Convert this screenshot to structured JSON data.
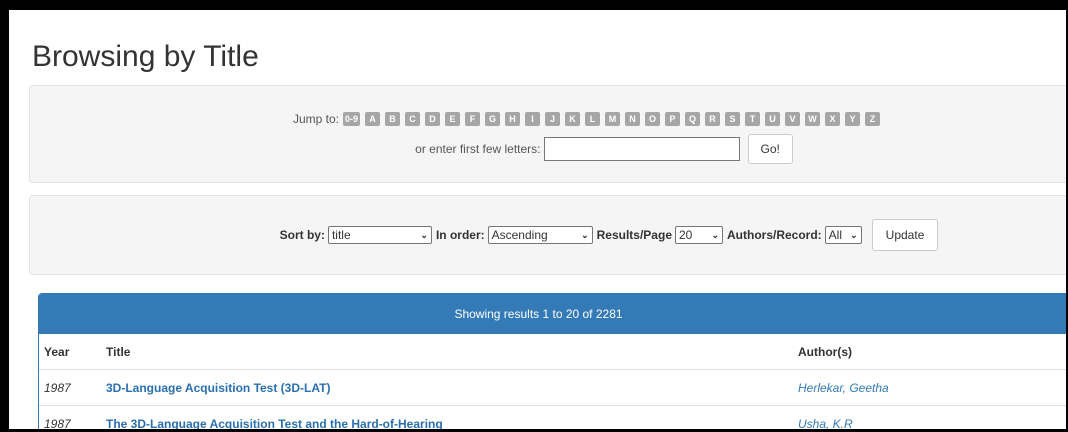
{
  "page_title": "Browsing by Title",
  "jump": {
    "label": "Jump to:",
    "letters": [
      "0-9",
      "A",
      "B",
      "C",
      "D",
      "E",
      "F",
      "G",
      "H",
      "I",
      "J",
      "K",
      "L",
      "M",
      "N",
      "O",
      "P",
      "Q",
      "R",
      "S",
      "T",
      "U",
      "V",
      "W",
      "X",
      "Y",
      "Z"
    ],
    "enter_label": "or enter first few letters:",
    "input_value": "",
    "go_label": "Go!"
  },
  "sort": {
    "sort_by_label": "Sort by:",
    "sort_by_value": "title",
    "order_label": "In order:",
    "order_value": "Ascending",
    "rpp_label": "Results/Page",
    "rpp_value": "20",
    "authors_label": "Authors/Record:",
    "authors_value": "All",
    "update_label": "Update"
  },
  "results": {
    "heading": "Showing results 1 to 20 of 2281",
    "columns": {
      "year": "Year",
      "title": "Title",
      "authors": "Author(s)"
    },
    "rows": [
      {
        "year": "1987",
        "title": "3D-Language Acquisition Test (3D-LAT)",
        "author": "Herlekar, Geetha"
      },
      {
        "year": "1987",
        "title": "The 3D-Language Acquisition Test and the Hard-of-Hearing",
        "author": "Usha, K.R"
      }
    ]
  },
  "colors": {
    "accent": "#337ab7",
    "letter_bg": "#a6a6a6",
    "well_bg": "#f5f5f5"
  }
}
